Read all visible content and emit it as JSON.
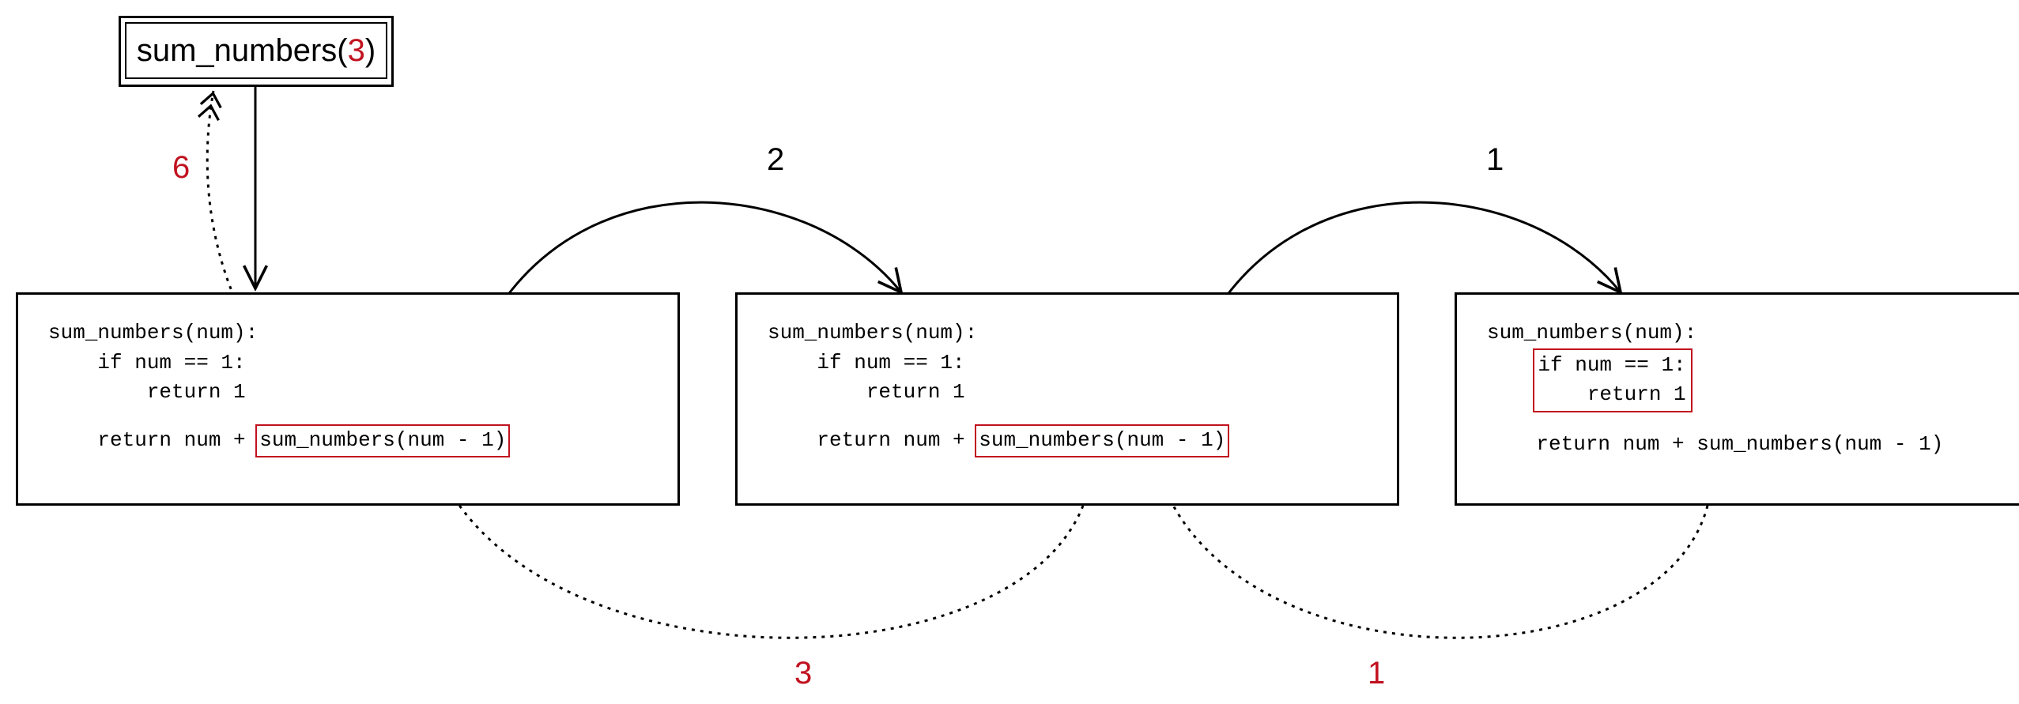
{
  "call": {
    "prefix": "sum_numbers(",
    "arg": "3",
    "suffix": ")"
  },
  "code": {
    "line1": "sum_numbers(num):",
    "line2": "    if num == 1:",
    "line3": "        return 1",
    "line4_prefix": "    return num + ",
    "line4_call": "sum_numbers(num - 1)",
    "base_line1": "if num == 1:",
    "base_line2": "    return 1"
  },
  "labels": {
    "down_fwd1": "2",
    "down_fwd2": "1",
    "ret_top": "6",
    "ret_mid": "3",
    "ret_right": "1"
  }
}
